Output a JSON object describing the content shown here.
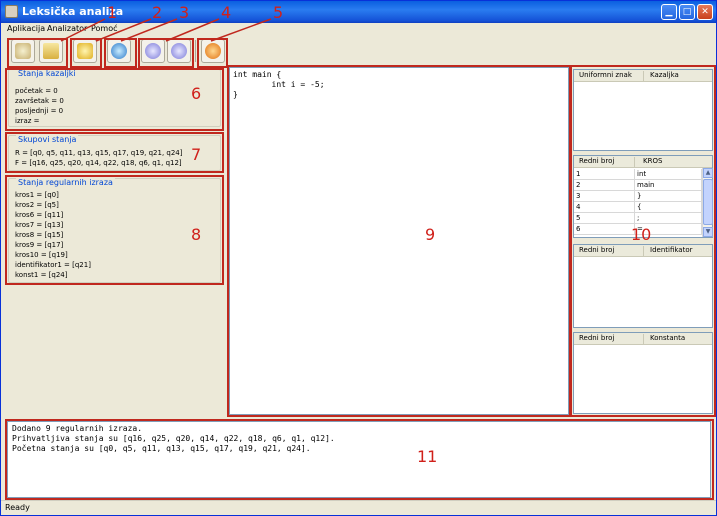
{
  "window": {
    "title": "Leksička analiza"
  },
  "menu": [
    "Aplikacija",
    "Analizator",
    "Pomoć"
  ],
  "callouts": [
    "1",
    "2",
    "3",
    "4",
    "5",
    "6",
    "7",
    "8",
    "9",
    "10",
    "11"
  ],
  "panels": {
    "kazaljke": {
      "title": "Stanja kazaljki",
      "lines": [
        "početak = 0",
        "završetak = 0",
        "posljednji = 0",
        "izraz ="
      ]
    },
    "skupovi": {
      "title": "Skupovi stanja",
      "lines": [
        "R = [q0, q5, q11, q13, q15, q17, q19, q21, q24]",
        "F = [q16, q25, q20, q14, q22, q18, q6, q1, q12]"
      ]
    },
    "regularni": {
      "title": "Stanja regularnih izraza",
      "lines": [
        "kros1 = [q0]",
        "kros2 = [q5]",
        "kros6 = [q11]",
        "kros7 = [q13]",
        "kros8 = [q15]",
        "kros9 = [q17]",
        "kros10 = [q19]",
        "identifikator1 = [q21]",
        "konst1 = [q24]"
      ]
    }
  },
  "editor": {
    "lines": [
      "int main {",
      "        int i = -5;",
      "}"
    ]
  },
  "tables": {
    "uniformni": {
      "headers": [
        "Uniformni znak",
        "Kazaljka"
      ]
    },
    "kros": {
      "headers": [
        "Redni broj",
        "KROS"
      ],
      "rows": [
        [
          "1",
          "int"
        ],
        [
          "2",
          "main"
        ],
        [
          "3",
          "}"
        ],
        [
          "4",
          "{"
        ],
        [
          "5",
          ";"
        ],
        [
          "6",
          "="
        ]
      ]
    },
    "identifikator": {
      "headers": [
        "Redni broj",
        "Identifikator"
      ]
    },
    "konstanta": {
      "headers": [
        "Redni broj",
        "Konstanta"
      ]
    }
  },
  "console": {
    "lines": [
      "Dodano 9 regularnih izraza.",
      "Prihvatljiva stanja su [q16, q25, q20, q14, q22, q18, q6, q1, q12].",
      "Početna stanja su [q0, q5, q11, q13, q15, q17, q19, q21, q24]."
    ]
  },
  "status": "Ready",
  "colors": {
    "callout": "#c0281e",
    "group_title": "#0046d5",
    "titlebar": "#0a5fe0"
  },
  "icons": [
    "app-icon",
    "minimize-icon",
    "maximize-icon",
    "close-icon",
    "save-icon",
    "document-icon",
    "reload-icon",
    "refresh-icon",
    "play-icon",
    "stop-icon",
    "help-icon"
  ]
}
